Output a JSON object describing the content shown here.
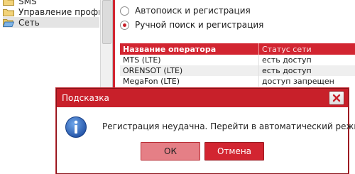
{
  "sidebar": {
    "items": [
      {
        "label": "SMS",
        "icon": "folder-icon"
      },
      {
        "label": "Управление профилями",
        "icon": "folder-icon"
      },
      {
        "label": "Сеть",
        "icon": "folder-icon",
        "selected": true
      }
    ]
  },
  "network_search": {
    "options": [
      {
        "label": "Автопоиск и регистрация",
        "selected": false
      },
      {
        "label": "Ручной поиск и регистрация",
        "selected": true
      }
    ]
  },
  "operator_table": {
    "columns": [
      "Название оператора",
      "Статус сети"
    ],
    "rows": [
      [
        "MTS (LTE)",
        "есть доступ"
      ],
      [
        "ORENSOT (LTE)",
        "есть доступ"
      ],
      [
        "MegaFon (LTE)",
        "доступ запрещен"
      ]
    ]
  },
  "dialog": {
    "title": "Подсказка",
    "message": "Регистрация неудачна. Перейти в автоматический режим?",
    "ok_label": "ОК",
    "cancel_label": "Отмена",
    "icon": "info-icon"
  },
  "colors": {
    "accent": "#d22531",
    "ok_button": "#e57f86",
    "cancel_button": "#d22531"
  }
}
